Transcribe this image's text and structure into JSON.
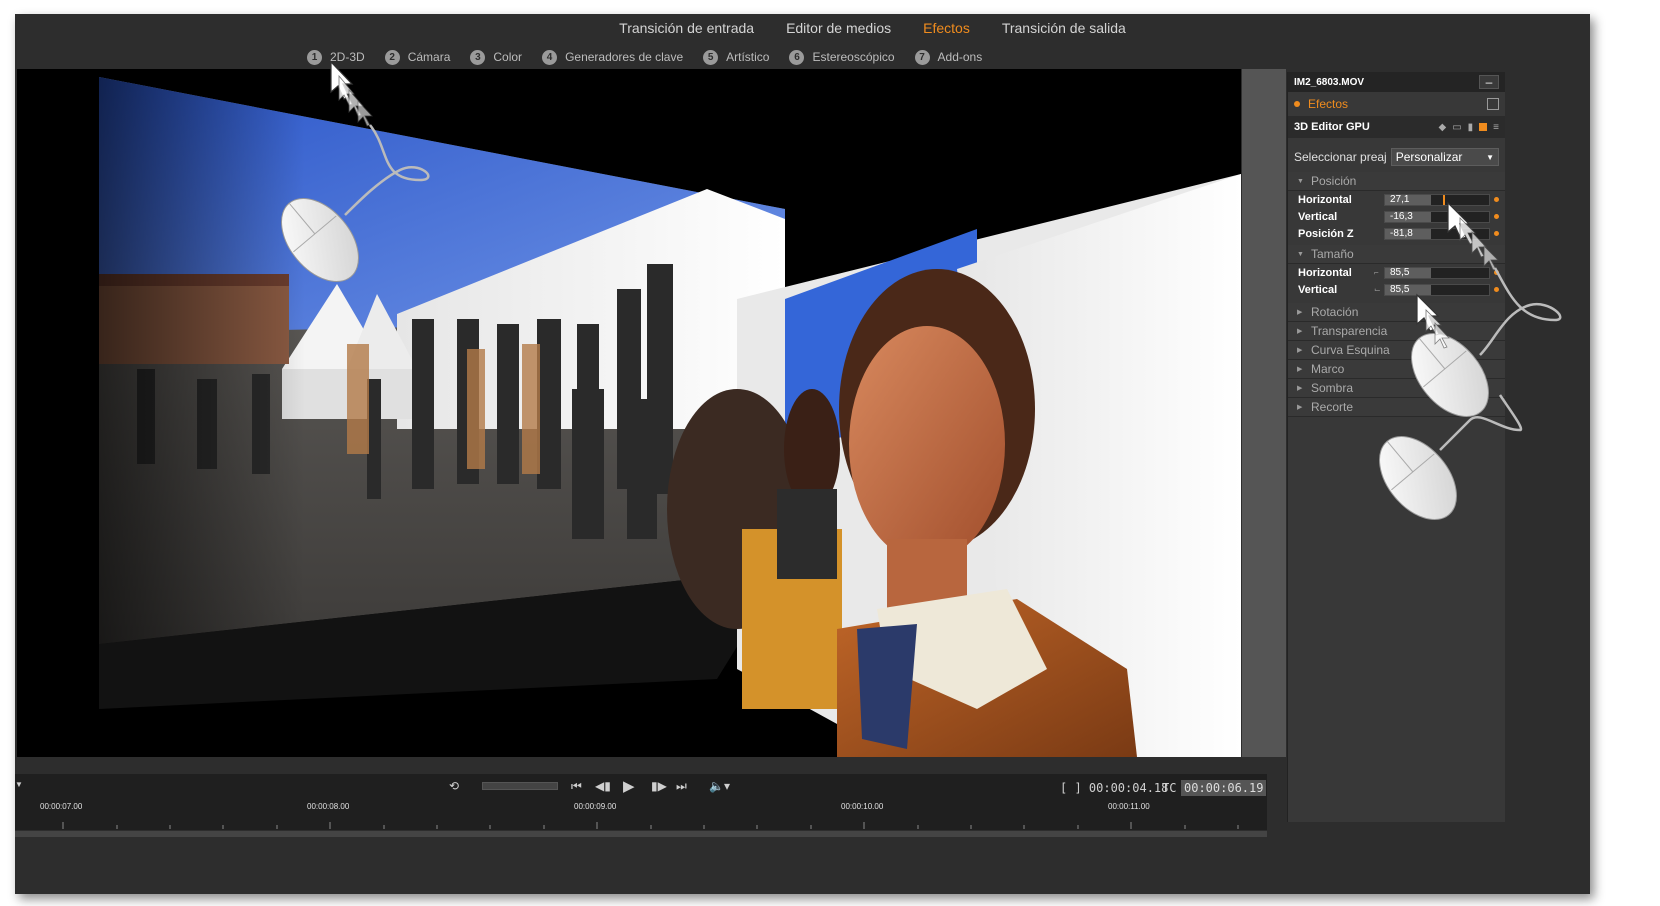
{
  "top_tabs": [
    {
      "label": "Transición de entrada"
    },
    {
      "label": "Editor de medios"
    },
    {
      "label": "Efectos"
    },
    {
      "label": "Transición de salida"
    }
  ],
  "sub_tabs": [
    {
      "num": "1",
      "label": "2D-3D"
    },
    {
      "num": "2",
      "label": "Cámara"
    },
    {
      "num": "3",
      "label": "Color"
    },
    {
      "num": "4",
      "label": "Generadores de clave"
    },
    {
      "num": "5",
      "label": "Artístico"
    },
    {
      "num": "6",
      "label": "Estereoscópico"
    },
    {
      "num": "7",
      "label": "Add-ons"
    }
  ],
  "panel": {
    "clip_name": "IM2_6803.MOV",
    "minus_label": "–",
    "effects_label": "Efectos",
    "editor_label": "3D Editor GPU",
    "preset_label": "Seleccionar preaj",
    "preset_value": "Personalizar",
    "sections": {
      "posicion": "Posición",
      "tamano": "Tamaño",
      "rotacion": "Rotación",
      "transparencia": "Transparencia",
      "curva": "Curva Esquina",
      "marco": "Marco",
      "sombra": "Sombra",
      "recorte": "Recorte"
    },
    "posicion_params": [
      {
        "label": "Horizontal",
        "value": "27,1"
      },
      {
        "label": "Vertical",
        "value": "-16,3"
      },
      {
        "label": "Posición Z",
        "value": "-81,8"
      }
    ],
    "tamano_params": [
      {
        "label": "Horizontal",
        "value": "85,5"
      },
      {
        "label": "Vertical",
        "value": "85,5"
      }
    ]
  },
  "transport": {
    "timecode_in": "[ ] 00:00:04.18",
    "tc_label": "TC",
    "timecode_tc": "00:00:06.19"
  },
  "ruler": [
    "00:00:07.00",
    "00:00:08.00",
    "00:00:09.00",
    "00:00:10.00",
    "00:00:11.00"
  ]
}
